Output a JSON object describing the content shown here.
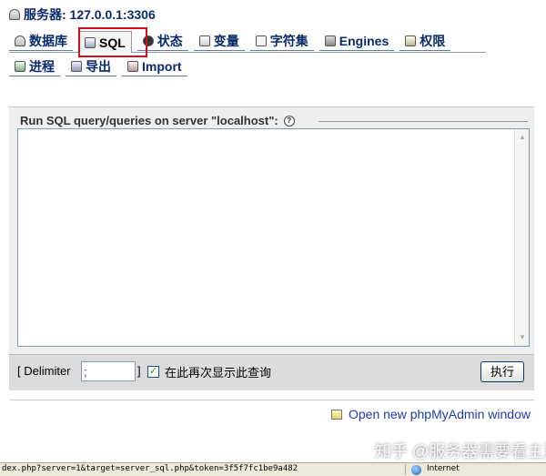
{
  "header": {
    "server_label": "服务器: 127.0.0.1:3306"
  },
  "tabs_row1": [
    {
      "label": "数据库",
      "icon": "database-icon"
    },
    {
      "label": "SQL",
      "icon": "sql-icon",
      "active": true
    },
    {
      "label": "状态",
      "icon": "status-icon"
    },
    {
      "label": "变量",
      "icon": "variables-icon"
    },
    {
      "label": "字符集",
      "icon": "charset-icon"
    },
    {
      "label": "Engines",
      "icon": "engines-icon"
    },
    {
      "label": "权限",
      "icon": "privileges-icon"
    }
  ],
  "tabs_row2": [
    {
      "label": "进程",
      "icon": "processes-icon"
    },
    {
      "label": "导出",
      "icon": "export-icon"
    },
    {
      "label": "Import",
      "icon": "import-icon"
    }
  ],
  "sql_panel": {
    "legend": "Run SQL query/queries on server \"localhost\":",
    "query_value": "",
    "delimiter_label": "[ Delimiter",
    "delimiter_value": ";",
    "delimiter_close": "]",
    "show_again_checked": true,
    "show_again_label": "在此再次显示此查询",
    "go_label": "执行"
  },
  "links": {
    "new_window": "Open new phpMyAdmin window"
  },
  "watermark": "知乎 @服务器需要看主页",
  "statusbar": {
    "url": "dex.php?server=1&target=server_sql.php&token=3f5f7fc1be9a482",
    "zone": "Internet"
  },
  "colors": {
    "highlight": "#d2101a",
    "link": "#1d3bb5",
    "tab_text": "#0a2a6a"
  }
}
